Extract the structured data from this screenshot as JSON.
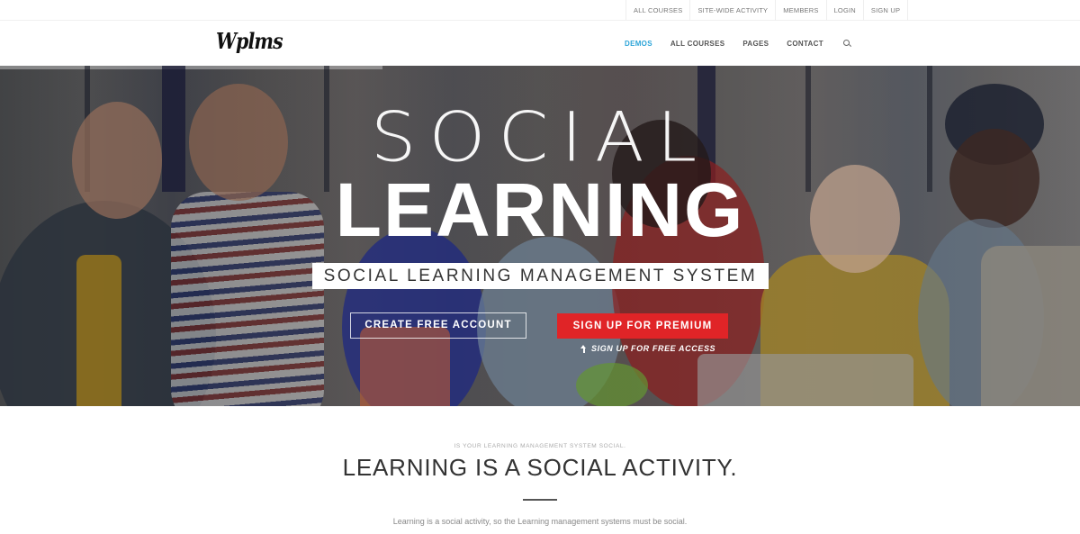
{
  "topbar": {
    "links": [
      "ALL COURSES",
      "SITE-WIDE ACTIVITY",
      "MEMBERS",
      "LOGIN",
      "SIGN UP"
    ]
  },
  "header": {
    "logo": "Wplms",
    "nav": [
      {
        "label": "DEMOS",
        "active": true
      },
      {
        "label": "ALL COURSES",
        "active": false
      },
      {
        "label": "PAGES",
        "active": false
      },
      {
        "label": "CONTACT",
        "active": false
      }
    ],
    "search_icon": "search-icon"
  },
  "hero": {
    "title_light": "SOCIAL",
    "title_bold": "LEARNING",
    "tagline": "SOCIAL LEARNING MANAGEMENT SYSTEM",
    "cta_secondary": "CREATE FREE ACCOUNT",
    "cta_primary": "SIGN UP FOR PREMIUM",
    "free_access_note": "SIGN UP FOR FREE ACCESS",
    "arrow_icon": "arrow-up-icon"
  },
  "intro": {
    "kicker": "IS YOUR LEARNING MANAGEMENT SYSTEM SOCIAL.",
    "headline": "LEARNING IS A SOCIAL ACTIVITY.",
    "lead": "Learning is a social activity, so the Learning management systems must be social."
  },
  "colors": {
    "accent": "#2ba4d8",
    "primary_button": "#e02427",
    "nav_text": "#555555"
  }
}
